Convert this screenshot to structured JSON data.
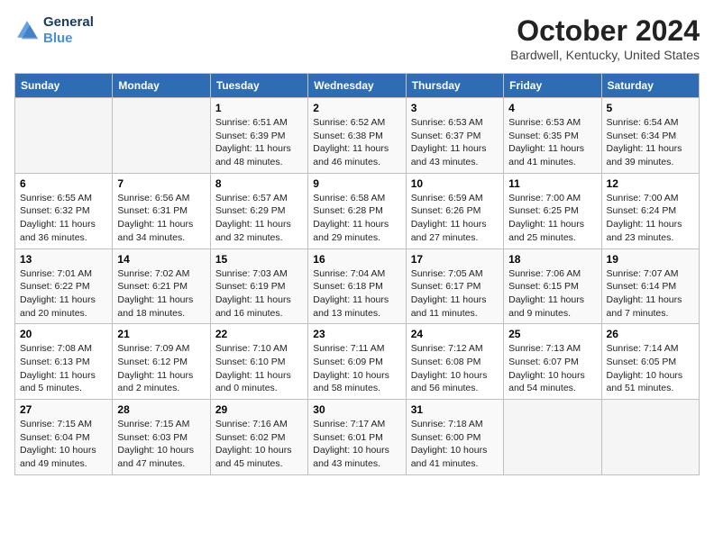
{
  "header": {
    "logo_line1": "General",
    "logo_line2": "Blue",
    "month": "October 2024",
    "location": "Bardwell, Kentucky, United States"
  },
  "days_of_week": [
    "Sunday",
    "Monday",
    "Tuesday",
    "Wednesday",
    "Thursday",
    "Friday",
    "Saturday"
  ],
  "weeks": [
    [
      {
        "num": "",
        "info": ""
      },
      {
        "num": "",
        "info": ""
      },
      {
        "num": "1",
        "info": "Sunrise: 6:51 AM\nSunset: 6:39 PM\nDaylight: 11 hours and 48 minutes."
      },
      {
        "num": "2",
        "info": "Sunrise: 6:52 AM\nSunset: 6:38 PM\nDaylight: 11 hours and 46 minutes."
      },
      {
        "num": "3",
        "info": "Sunrise: 6:53 AM\nSunset: 6:37 PM\nDaylight: 11 hours and 43 minutes."
      },
      {
        "num": "4",
        "info": "Sunrise: 6:53 AM\nSunset: 6:35 PM\nDaylight: 11 hours and 41 minutes."
      },
      {
        "num": "5",
        "info": "Sunrise: 6:54 AM\nSunset: 6:34 PM\nDaylight: 11 hours and 39 minutes."
      }
    ],
    [
      {
        "num": "6",
        "info": "Sunrise: 6:55 AM\nSunset: 6:32 PM\nDaylight: 11 hours and 36 minutes."
      },
      {
        "num": "7",
        "info": "Sunrise: 6:56 AM\nSunset: 6:31 PM\nDaylight: 11 hours and 34 minutes."
      },
      {
        "num": "8",
        "info": "Sunrise: 6:57 AM\nSunset: 6:29 PM\nDaylight: 11 hours and 32 minutes."
      },
      {
        "num": "9",
        "info": "Sunrise: 6:58 AM\nSunset: 6:28 PM\nDaylight: 11 hours and 29 minutes."
      },
      {
        "num": "10",
        "info": "Sunrise: 6:59 AM\nSunset: 6:26 PM\nDaylight: 11 hours and 27 minutes."
      },
      {
        "num": "11",
        "info": "Sunrise: 7:00 AM\nSunset: 6:25 PM\nDaylight: 11 hours and 25 minutes."
      },
      {
        "num": "12",
        "info": "Sunrise: 7:00 AM\nSunset: 6:24 PM\nDaylight: 11 hours and 23 minutes."
      }
    ],
    [
      {
        "num": "13",
        "info": "Sunrise: 7:01 AM\nSunset: 6:22 PM\nDaylight: 11 hours and 20 minutes."
      },
      {
        "num": "14",
        "info": "Sunrise: 7:02 AM\nSunset: 6:21 PM\nDaylight: 11 hours and 18 minutes."
      },
      {
        "num": "15",
        "info": "Sunrise: 7:03 AM\nSunset: 6:19 PM\nDaylight: 11 hours and 16 minutes."
      },
      {
        "num": "16",
        "info": "Sunrise: 7:04 AM\nSunset: 6:18 PM\nDaylight: 11 hours and 13 minutes."
      },
      {
        "num": "17",
        "info": "Sunrise: 7:05 AM\nSunset: 6:17 PM\nDaylight: 11 hours and 11 minutes."
      },
      {
        "num": "18",
        "info": "Sunrise: 7:06 AM\nSunset: 6:15 PM\nDaylight: 11 hours and 9 minutes."
      },
      {
        "num": "19",
        "info": "Sunrise: 7:07 AM\nSunset: 6:14 PM\nDaylight: 11 hours and 7 minutes."
      }
    ],
    [
      {
        "num": "20",
        "info": "Sunrise: 7:08 AM\nSunset: 6:13 PM\nDaylight: 11 hours and 5 minutes."
      },
      {
        "num": "21",
        "info": "Sunrise: 7:09 AM\nSunset: 6:12 PM\nDaylight: 11 hours and 2 minutes."
      },
      {
        "num": "22",
        "info": "Sunrise: 7:10 AM\nSunset: 6:10 PM\nDaylight: 11 hours and 0 minutes."
      },
      {
        "num": "23",
        "info": "Sunrise: 7:11 AM\nSunset: 6:09 PM\nDaylight: 10 hours and 58 minutes."
      },
      {
        "num": "24",
        "info": "Sunrise: 7:12 AM\nSunset: 6:08 PM\nDaylight: 10 hours and 56 minutes."
      },
      {
        "num": "25",
        "info": "Sunrise: 7:13 AM\nSunset: 6:07 PM\nDaylight: 10 hours and 54 minutes."
      },
      {
        "num": "26",
        "info": "Sunrise: 7:14 AM\nSunset: 6:05 PM\nDaylight: 10 hours and 51 minutes."
      }
    ],
    [
      {
        "num": "27",
        "info": "Sunrise: 7:15 AM\nSunset: 6:04 PM\nDaylight: 10 hours and 49 minutes."
      },
      {
        "num": "28",
        "info": "Sunrise: 7:15 AM\nSunset: 6:03 PM\nDaylight: 10 hours and 47 minutes."
      },
      {
        "num": "29",
        "info": "Sunrise: 7:16 AM\nSunset: 6:02 PM\nDaylight: 10 hours and 45 minutes."
      },
      {
        "num": "30",
        "info": "Sunrise: 7:17 AM\nSunset: 6:01 PM\nDaylight: 10 hours and 43 minutes."
      },
      {
        "num": "31",
        "info": "Sunrise: 7:18 AM\nSunset: 6:00 PM\nDaylight: 10 hours and 41 minutes."
      },
      {
        "num": "",
        "info": ""
      },
      {
        "num": "",
        "info": ""
      }
    ]
  ]
}
